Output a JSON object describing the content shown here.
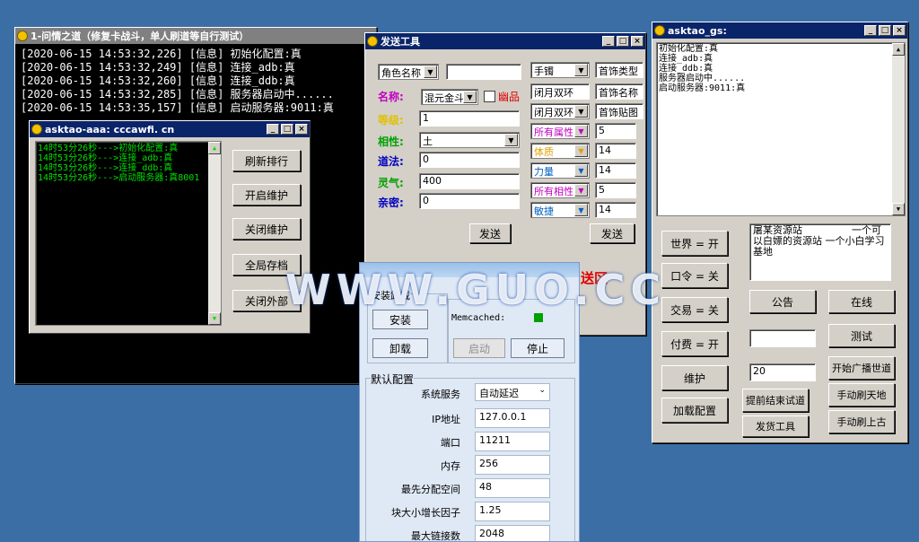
{
  "console": {
    "title": "1-问情之道（修复卡战斗，单人刷道等自行测试）",
    "lines": [
      "[2020-06-15 14:53:32,226] [信息] 初始化配置:真",
      "[2020-06-15 14:53:32,249] [信息] 连接_adb:真",
      "[2020-06-15 14:53:32,260] [信息] 连接_ddb:真",
      "[2020-06-15 14:53:32,285] [信息] 服务器启动中......",
      "[2020-06-15 14:53:35,157] [信息] 启动服务器:9011:真"
    ]
  },
  "small_window": {
    "title": "asktao-aaa: cccawfi. cn",
    "log": [
      "14时53分26秒--->初始化配置:真",
      "14时53分26秒--->连接_adb:真",
      "14时53分26秒--->连接_ddb:真",
      "14时53分26秒--->启动服务器:真8001"
    ],
    "buttons": [
      "刷新排行",
      "开启维护",
      "关闭维护",
      "全局存档",
      "关闭外部"
    ]
  },
  "send_tool": {
    "title": "发送工具",
    "role_select": "角色名称",
    "name_label": "名称:",
    "name_select": "混元金斗",
    "unique_label": "幽品",
    "level_label": "等级:",
    "level_value": "1",
    "attr_label": "相性:",
    "attr_value": "土",
    "dao_label": "道法:",
    "dao_value": "0",
    "qi_label": "灵气:",
    "qi_value": "400",
    "close_label": "亲密:",
    "close_value": "0",
    "right_selects": [
      "手镯",
      "闭月双环",
      "闭月双环"
    ],
    "right_values": [
      "首饰类型",
      "首饰名称",
      "首饰贴图"
    ],
    "stat_selects": [
      "所有属性",
      "体质",
      "力量",
      "所有相性",
      "敏捷"
    ],
    "stat_values": [
      "5",
      "14",
      "14",
      "5",
      "14"
    ],
    "send1": "发送",
    "send2": "发送",
    "red_text": "送区"
  },
  "gs": {
    "title": "asktao_gs:",
    "log": [
      "初始化配置:真",
      "连接_adb:真",
      "连接_ddb:真",
      "服务器启动中......",
      "启动服务器:9011:真"
    ],
    "announce": "屠某资源站　　　　　一个可以白嫖的资源站 一个小白学习基地",
    "left_buttons": [
      "世界 = 开",
      "口令 = 关",
      "交易 = 关",
      "付费 = 开",
      "维护",
      "加载配置"
    ],
    "notice_btn": "公告",
    "online_btn": "在线",
    "test_btn": "测试",
    "broadcast_btn": "开始广播世道",
    "number_value": "20",
    "end_trial_btn": "提前结束试道",
    "send_tool_btn": "发货工具",
    "refresh_tiandi_btn": "手动刷天地",
    "refresh_shanggu_btn": "手动刷上古"
  },
  "memcached": {
    "install_group": "安装卸载",
    "install_btn": "安装",
    "uninstall_btn": "卸载",
    "status_label": "Memcached:",
    "start_btn": "启动",
    "stop_btn": "停止",
    "config_group": "默认配置",
    "fields": [
      {
        "label": "系统服务",
        "value": "自动延迟"
      },
      {
        "label": "IP地址",
        "value": "127.0.0.1"
      },
      {
        "label": "端口",
        "value": "11211"
      },
      {
        "label": "内存",
        "value": "256"
      },
      {
        "label": "最先分配空间",
        "value": "48"
      },
      {
        "label": "块大小增长因子",
        "value": "1.25"
      },
      {
        "label": "最大链接数",
        "value": "2048"
      }
    ]
  },
  "watermark": "WWW.GUO.CC",
  "colors": {
    "name": "#c000c0",
    "level": "#e0c000",
    "attr": "#00a000",
    "dao": "#0000c0",
    "qi": "#00a000",
    "close": "#0000c0",
    "status_green": "#00a000",
    "unique_red": "#e00000"
  }
}
